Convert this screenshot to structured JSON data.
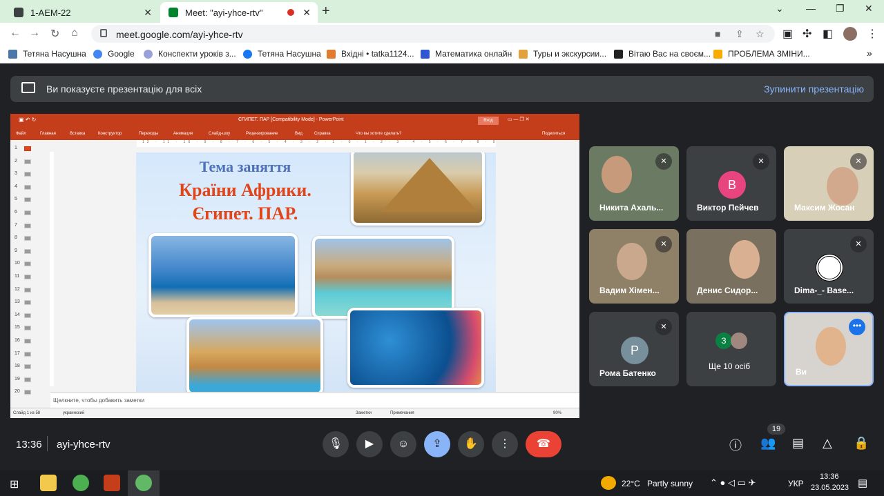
{
  "browser": {
    "tabs": [
      {
        "title": "1-AEM-22"
      },
      {
        "title": "Meet: \"ayi-yhce-rtv\""
      }
    ],
    "url": "meet.google.com/ayi-yhce-rtv",
    "bookmarks": [
      "Тетяна Насушна",
      "Google",
      "Конспекти уроків з...",
      "Тетяна Насушна",
      "Вхідні • tatka1124...",
      "Математика онлайн",
      "Туры и экскурсии...",
      "Вітаю Вас на своєм...",
      "ПРОБЛЕМА ЗМІНИ..."
    ]
  },
  "meet": {
    "banner_text": "Ви показуєте презентацію для всіх",
    "stop_label": "Зупинити презентацію",
    "time": "13:36",
    "meeting_code": "ayi-yhce-rtv",
    "people_count": "19",
    "participants": [
      {
        "name": "Никита Ахаль..."
      },
      {
        "name": "Виктор Пейчев",
        "initial": "В"
      },
      {
        "name": "Максим Жосан"
      },
      {
        "name": "Вадим Хімен..."
      },
      {
        "name": "Денис Сидор..."
      },
      {
        "name": "Dima-_- Base..."
      },
      {
        "name": "Рома Батенко",
        "initial": "Р"
      },
      {
        "name": "Ще 10 осіб",
        "initial": "З"
      },
      {
        "name": "Ви"
      }
    ]
  },
  "powerpoint": {
    "title": "ЄГИПЕТ. ПАР [Compatibility Mode] - PowerPoint",
    "login": "Вход",
    "menu": [
      "Файл",
      "Главная",
      "Вставка",
      "Конструктор",
      "Переходы",
      "Анимация",
      "Слайд-шоу",
      "Рецензирование",
      "Вид",
      "Справка",
      "Что вы хотите сделать?",
      "Поделиться"
    ],
    "ruler": "12 · 11 · 10 · 9 · 8 · 7 · 6 · 5 · 4 · 3 · 2 · 1 · 0 · 1 · 2 · 3 · 4 · 5 · 6 · 7 · 8 · 9 · 10 · 11 · 12",
    "slide_numbers": [
      "1",
      "2",
      "3",
      "4",
      "5",
      "6",
      "7",
      "8",
      "9",
      "10",
      "11",
      "12",
      "13",
      "14",
      "15",
      "16",
      "17",
      "18",
      "19",
      "20"
    ],
    "slide": {
      "topic": "Тема заняття",
      "line1": "Країни Африки.",
      "line2": "Єгипет. ПАР."
    },
    "notes_placeholder": "Щелкните, чтобы добавить заметки",
    "status": {
      "slide": "Слайд 1 из 58",
      "lang": "украинский",
      "notes": "Заметки",
      "comments": "Примечания",
      "zoom": "90%"
    }
  },
  "taskbar": {
    "weather_temp": "22°C",
    "weather_text": "Partly sunny",
    "lang": "УКР",
    "time": "13:36",
    "date": "23.05.2023"
  }
}
